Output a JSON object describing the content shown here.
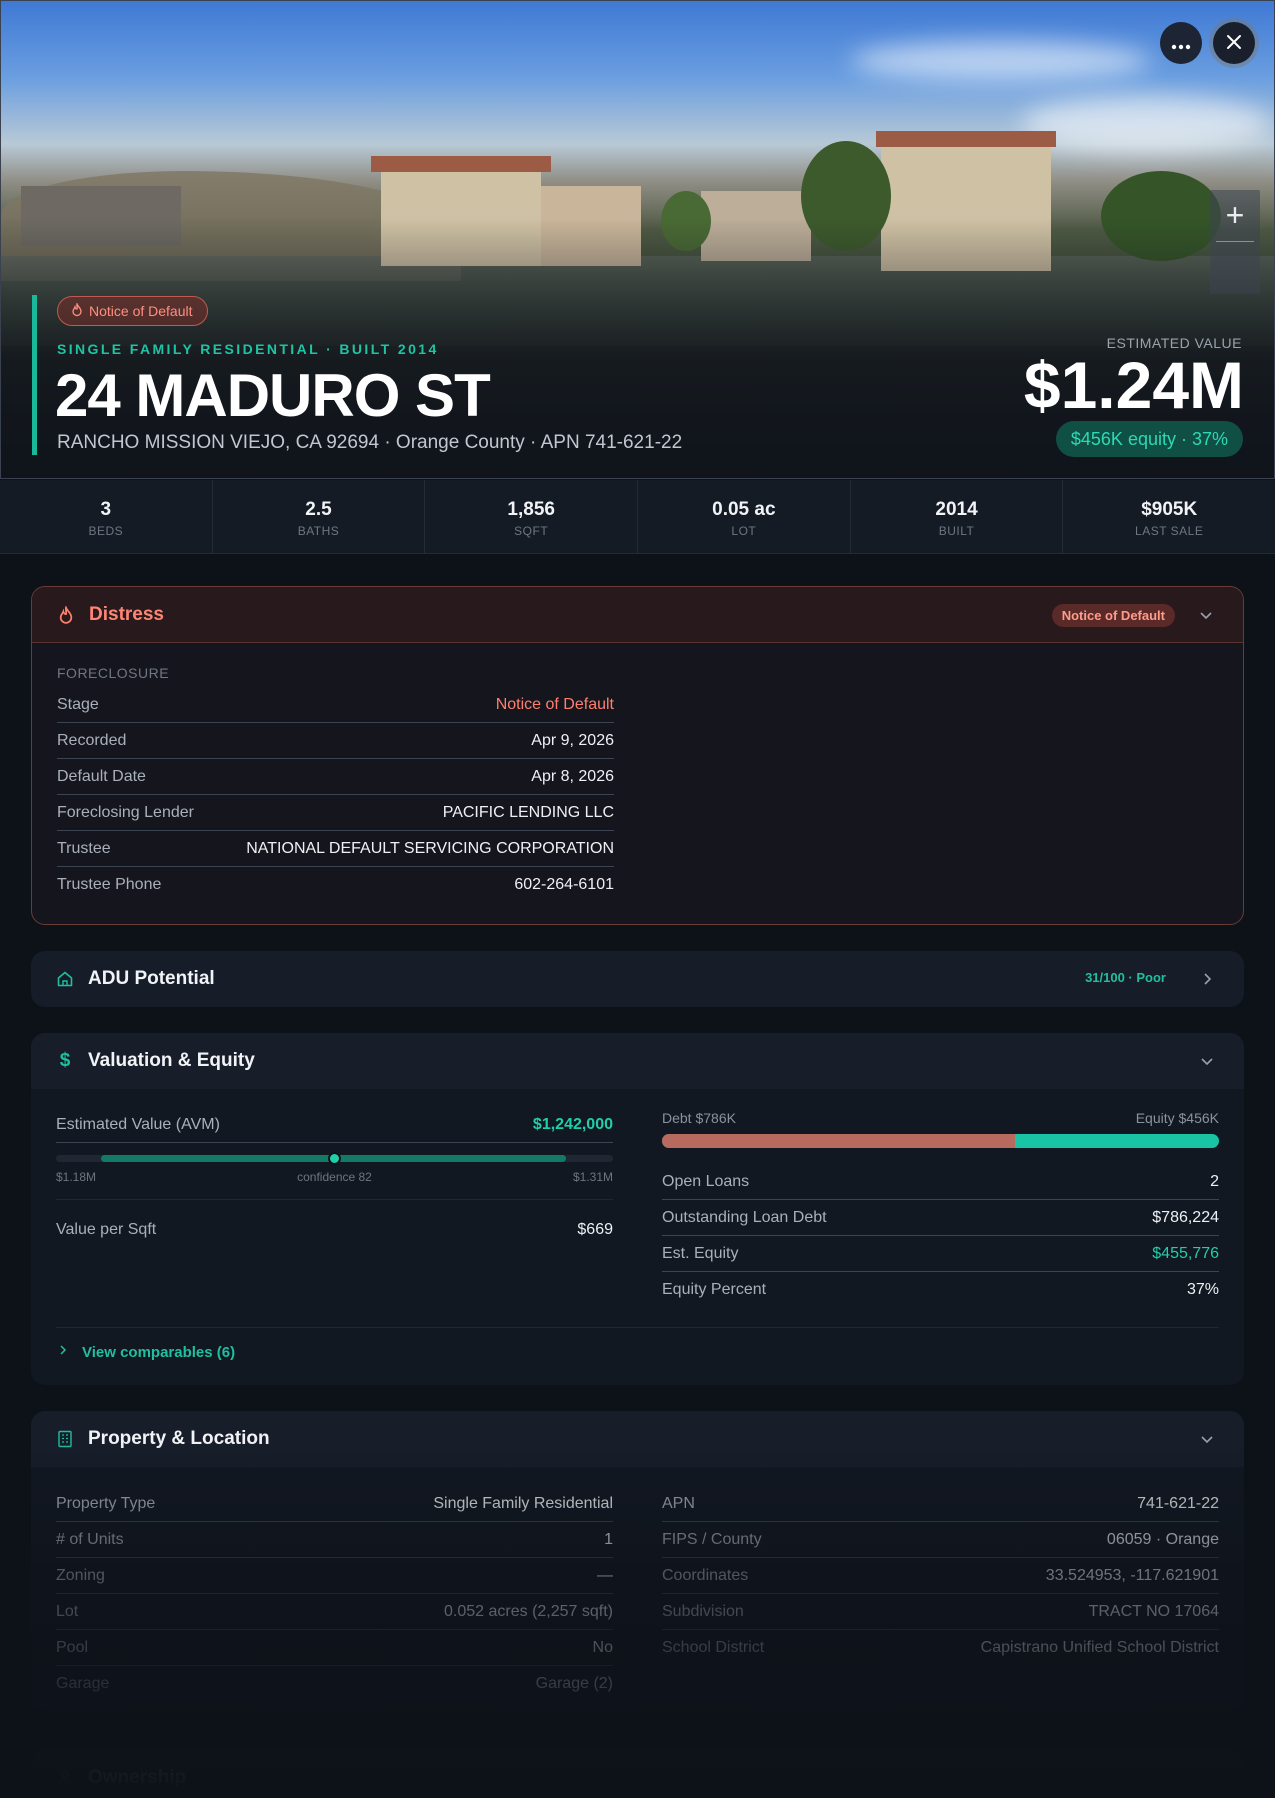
{
  "hero": {
    "badge": "Notice of Default",
    "kicker": "SINGLE FAMILY RESIDENTIAL · BUILT 2014",
    "address": "24 MADURO ST",
    "subline": "RANCHO MISSION VIEJO, CA 92694 · Orange County · APN 741-621-22",
    "estimated_value_label": "ESTIMATED VALUE",
    "estimated_value": "$1.24M",
    "equity_pill": "$456K equity · 37%"
  },
  "stats": [
    {
      "value": "3",
      "label": "BEDS"
    },
    {
      "value": "2.5",
      "label": "BATHS"
    },
    {
      "value": "1,856",
      "label": "SQFT"
    },
    {
      "value": "0.05 ac",
      "label": "LOT"
    },
    {
      "value": "2014",
      "label": "BUILT"
    },
    {
      "value": "$905K",
      "label": "LAST SALE"
    }
  ],
  "distress": {
    "title": "Distress",
    "badge": "Notice of Default",
    "section_label": "FORECLOSURE",
    "rows": [
      {
        "key": "Stage",
        "value": "Notice of Default"
      },
      {
        "key": "Recorded",
        "value": "Apr 9, 2026"
      },
      {
        "key": "Default Date",
        "value": "Apr 8, 2026"
      },
      {
        "key": "Foreclosing Lender",
        "value": "PACIFIC LENDING LLC"
      },
      {
        "key": "Trustee",
        "value": "NATIONAL DEFAULT SERVICING CORPORATION"
      },
      {
        "key": "Trustee Phone",
        "value": "602-264-6101"
      }
    ]
  },
  "adu": {
    "title": "ADU Potential",
    "score": "31/100 · Poor"
  },
  "valuation": {
    "title": "Valuation & Equity",
    "avm_label": "Estimated Value (AVM)",
    "avm_value": "$1,242,000",
    "range_low": "$1.18M",
    "range_high": "$1.31M",
    "confidence": "confidence 82",
    "avm_position": 0.5,
    "value_per_sqft_label": "Value per Sqft",
    "value_per_sqft": "$669",
    "debt_label": "Debt $786K",
    "equity_label": "Equity $456K",
    "debt_fraction": 0.633,
    "rows": [
      {
        "key": "Open Loans",
        "value": "2"
      },
      {
        "key": "Outstanding Loan Debt",
        "value": "$786,224"
      },
      {
        "key": "Est. Equity",
        "value": "$455,776"
      },
      {
        "key": "Equity Percent",
        "value": "37%"
      }
    ],
    "comparables_link": "View comparables (6)"
  },
  "property": {
    "title": "Property & Location",
    "left_rows": [
      {
        "key": "Property Type",
        "value": "Single Family Residential"
      },
      {
        "key": "# of Units",
        "value": "1"
      },
      {
        "key": "Zoning",
        "value": "—"
      },
      {
        "key": "Lot",
        "value": "0.052 acres (2,257 sqft)"
      },
      {
        "key": "Pool",
        "value": "No"
      },
      {
        "key": "Garage",
        "value": "Garage (2)"
      }
    ],
    "right_rows": [
      {
        "key": "APN",
        "value": "741-621-22"
      },
      {
        "key": "FIPS / County",
        "value": "06059 · Orange"
      },
      {
        "key": "Coordinates",
        "value": "33.524953, -117.621901"
      },
      {
        "key": "Subdivision",
        "value": "TRACT NO 17064"
      },
      {
        "key": "School District",
        "value": "Capistrano Unified School District"
      }
    ]
  },
  "ownership": {
    "title": "Ownership"
  },
  "colors": {
    "accent": "#19b89a",
    "distress": "#ff7f6e",
    "debt": "#b86a5e",
    "equity": "#19c4a4"
  }
}
